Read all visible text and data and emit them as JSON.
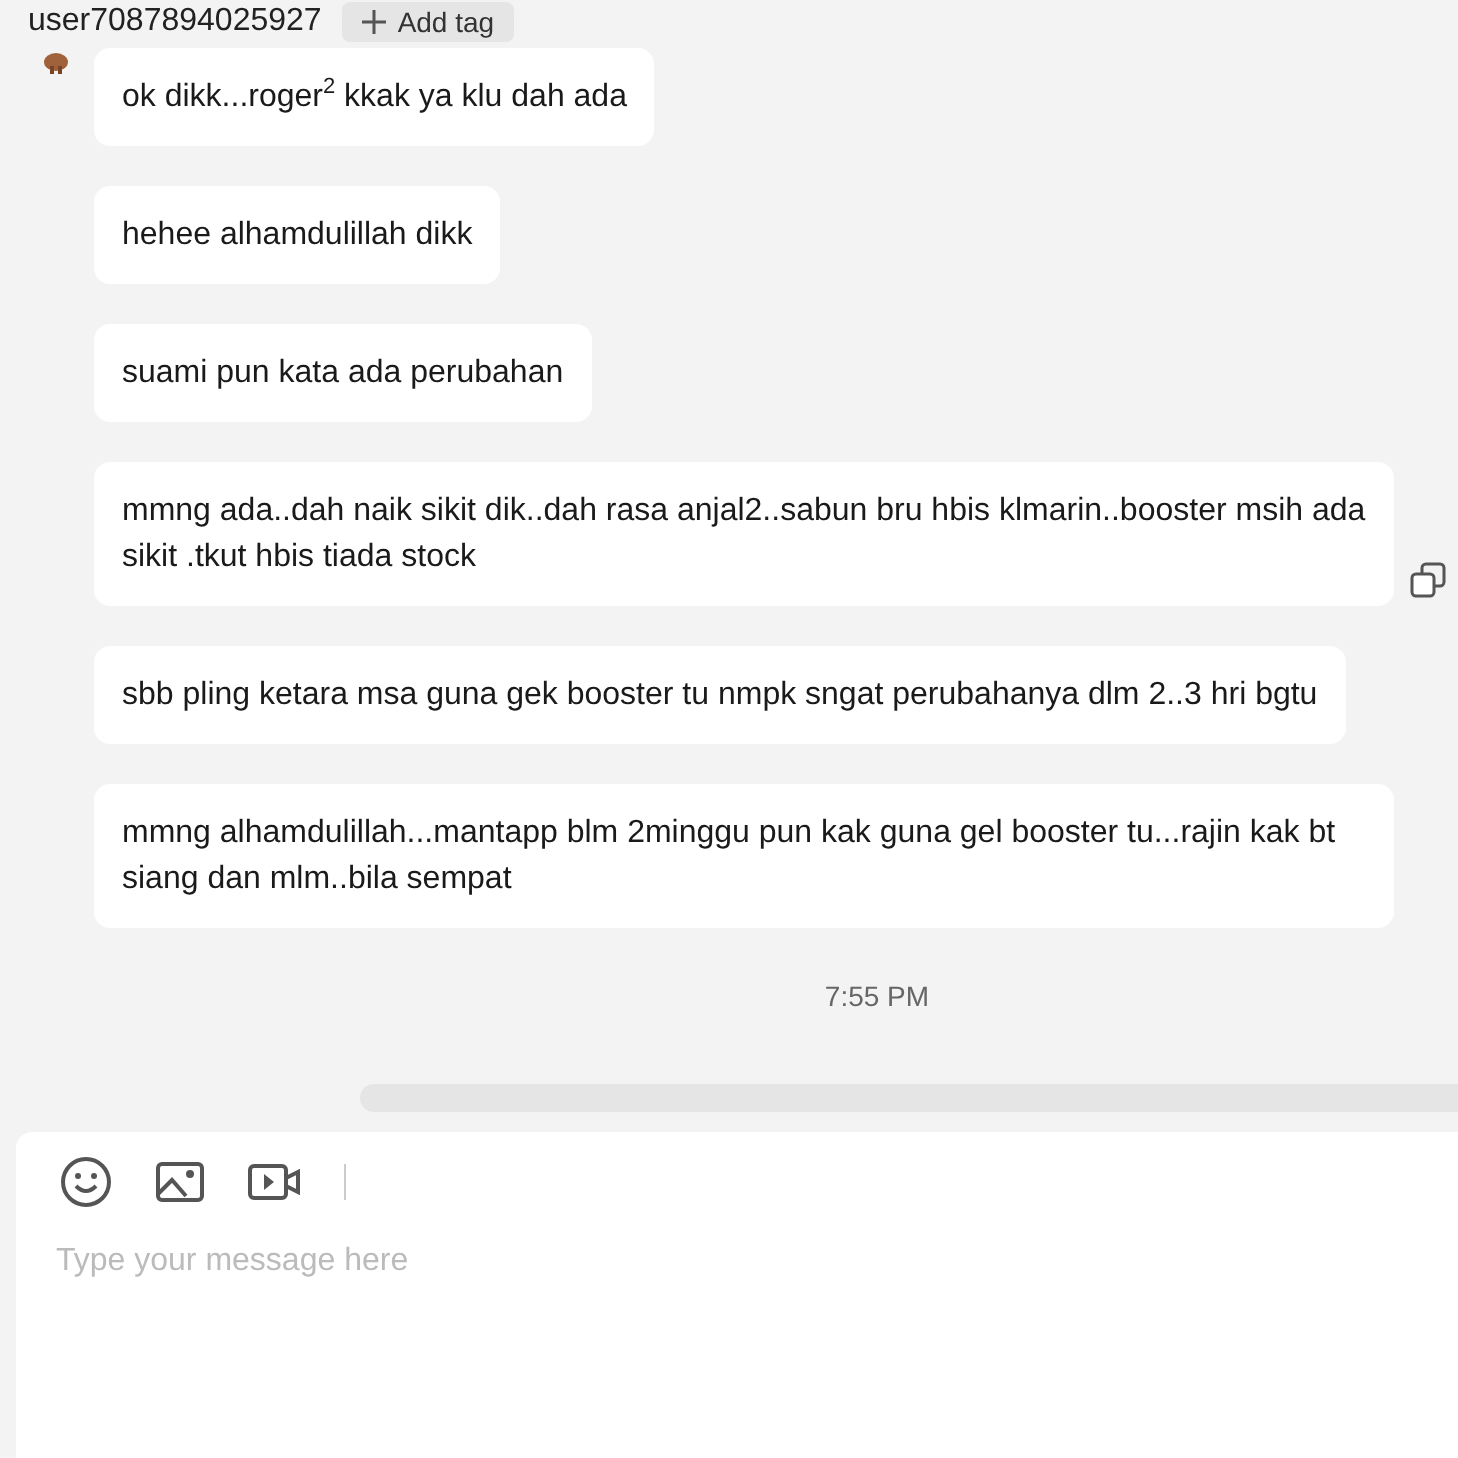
{
  "header": {
    "username": "user7087894025927",
    "tag_button": "Add tag"
  },
  "messages": [
    {
      "text": "ok dikk...roger$^{2}$ kkak ya klu dah ada",
      "avatar": true,
      "copy_icon": false
    },
    {
      "text": "hehee alhamdulillah dikk",
      "avatar": false,
      "copy_icon": false
    },
    {
      "text": "suami pun kata ada perubahan",
      "avatar": false,
      "copy_icon": false
    },
    {
      "text": "mmng ada..dah naik sikit dik..dah rasa anjal2..sabun bru hbis klmarin..booster msih ada sikit .tkut hbis tiada stock",
      "avatar": false,
      "copy_icon": true
    },
    {
      "text": "sbb pling ketara msa guna gek booster tu nmpk sngat perubahanya dlm 2..3 hri bgtu",
      "avatar": false,
      "copy_icon": false
    },
    {
      "text": "mmng alhamdulillah...mantapp blm 2minggu pun kak guna gel booster tu...rajin kak bt siang dan mlm..bila sempat",
      "avatar": false,
      "copy_icon": false
    }
  ],
  "timestamp": "7:55 PM",
  "composer": {
    "placeholder": "Type your message here"
  }
}
